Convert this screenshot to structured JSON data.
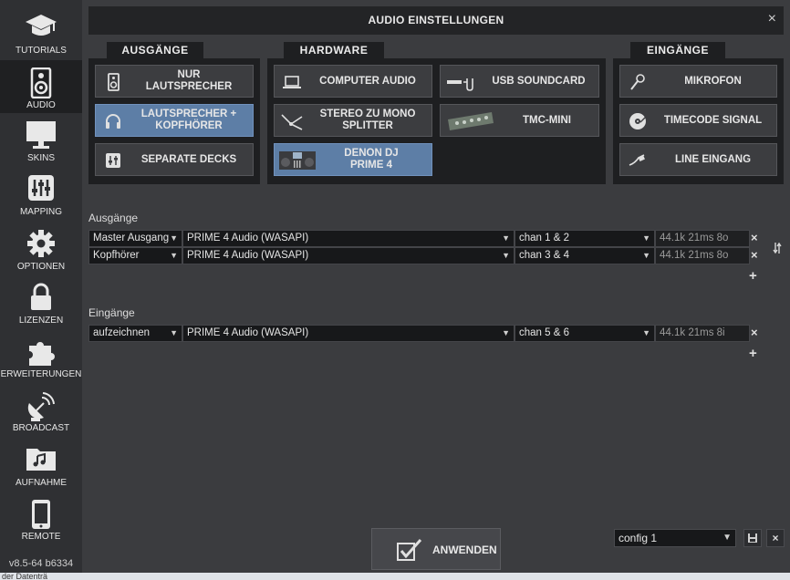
{
  "sidebar": {
    "items": [
      {
        "label": "TUTORIALS",
        "icon": "graduation-cap-icon"
      },
      {
        "label": "AUDIO",
        "icon": "speaker-icon",
        "active": true
      },
      {
        "label": "SKINS",
        "icon": "monitor-icon"
      },
      {
        "label": "MAPPING",
        "icon": "sliders-icon"
      },
      {
        "label": "OPTIONEN",
        "icon": "gear-icon"
      },
      {
        "label": "LIZENZEN",
        "icon": "lock-icon"
      },
      {
        "label": "ERWEITERUNGEN",
        "icon": "puzzle-icon"
      },
      {
        "label": "BROADCAST",
        "icon": "satellite-dish-icon"
      },
      {
        "label": "AUFNAHME",
        "icon": "music-folder-icon"
      },
      {
        "label": "REMOTE",
        "icon": "phone-icon"
      }
    ],
    "version": "v8.5-64 b6334"
  },
  "dialog": {
    "title": "AUDIO EINSTELLUNGEN",
    "close": "×"
  },
  "sections": {
    "outputs": {
      "tab": "AUSGÄNGE",
      "options": [
        {
          "label": "NUR\nLAUTSPRECHER",
          "selected": false
        },
        {
          "label": "LAUTSPRECHER +\nKOPFHÖRER",
          "selected": true
        },
        {
          "label": "SEPARATE DECKS",
          "selected": false
        }
      ]
    },
    "hardware": {
      "tab": "HARDWARE",
      "options": [
        {
          "label": "COMPUTER AUDIO",
          "selected": false
        },
        {
          "label": "USB SOUNDCARD",
          "selected": false
        },
        {
          "label": "STEREO ZU MONO\nSPLITTER",
          "selected": false
        },
        {
          "label": "TMC-MINI",
          "selected": false
        },
        {
          "label": "DENON DJ\nPRIME 4",
          "selected": true
        }
      ]
    },
    "inputs": {
      "tab": "EINGÄNGE",
      "options": [
        {
          "label": "MIKROFON",
          "selected": false
        },
        {
          "label": "TIMECODE SIGNAL",
          "selected": false
        },
        {
          "label": "LINE EINGANG",
          "selected": false
        }
      ]
    }
  },
  "outputs_table": {
    "label": "Ausgänge",
    "rows": [
      {
        "type": "Master Ausgang",
        "device": "PRIME 4 Audio (WASAPI)",
        "channel": "chan 1 & 2",
        "info": "44.1k 21ms 8o"
      },
      {
        "type": "Kopfhörer",
        "device": "PRIME 4 Audio (WASAPI)",
        "channel": "chan 3 & 4",
        "info": "44.1k 21ms 8o"
      }
    ],
    "remove": "×",
    "add": "+"
  },
  "inputs_table": {
    "label": "Eingänge",
    "rows": [
      {
        "type": "aufzeichnen",
        "device": "PRIME 4 Audio (WASAPI)",
        "channel": "chan 5 & 6",
        "info": "44.1k 21ms 8i"
      }
    ],
    "remove": "×",
    "add": "+"
  },
  "footer": {
    "apply": "ANWENDEN",
    "config": "config 1",
    "delete": "×"
  },
  "taskbar": {
    "left_text": "der Datenträ"
  },
  "colors": {
    "selected": "#5d7ea6",
    "panel": "#1e1f21",
    "background": "#3b3c3f"
  }
}
